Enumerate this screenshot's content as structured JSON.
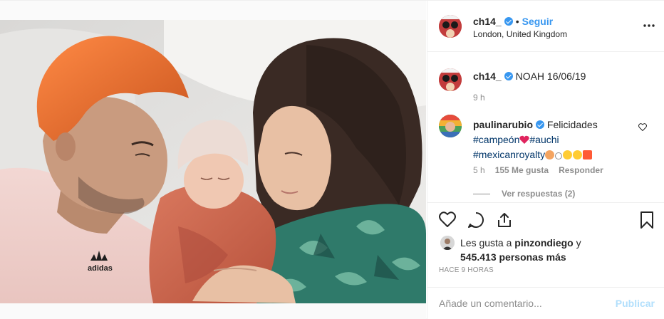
{
  "author": {
    "username": "ch14_",
    "follow_label": "Seguir",
    "separator": "•",
    "location": "London, United Kingdom"
  },
  "header": {
    "more_label": "•••"
  },
  "caption": {
    "username": "ch14_",
    "text": "NOAH 16/06/19",
    "time": "9 h"
  },
  "comment": {
    "username": "paulinarubio",
    "text": "Felicidades",
    "hashtag1": "#campeón",
    "hashtag2": "#auchi",
    "hashtag3": "#mexicanroyalty",
    "time": "5 h",
    "likes": "155 Me gusta",
    "reply_label": "Responder",
    "view_replies": "Ver respuestas (2)"
  },
  "likes": {
    "prefix": "Les gusta a",
    "user": "pinzondiego",
    "connector": "y",
    "count": "545.413 personas más"
  },
  "timestamp": "HACE 9 HORAS",
  "add_comment": {
    "placeholder": "Añade un comentario...",
    "publish_label": "Publicar"
  },
  "colors": {
    "accent": "#3897f0",
    "publish_disabled": "#b2dffc",
    "hashtag": "#003569",
    "muted": "#8e8e8e"
  },
  "icons": [
    "more-icon",
    "heart-icon",
    "comment-icon",
    "share-icon",
    "bookmark-icon",
    "verified-icon"
  ]
}
